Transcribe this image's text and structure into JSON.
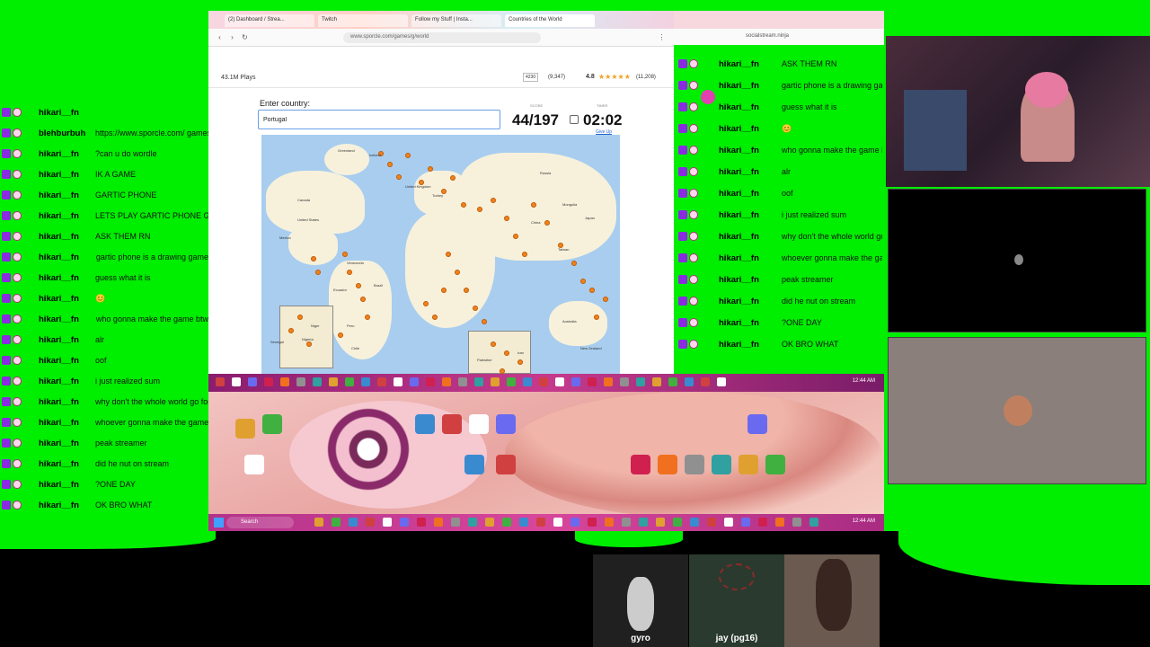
{
  "browser": {
    "tabs": [
      "(2) Dashboard / Strea...",
      "Twitch",
      "Follow my Stuff | Insta...",
      "Countries of the World"
    ],
    "url": "www.sporcle.com/games/g/world"
  },
  "quiz": {
    "plays": "43.1M Plays",
    "rating_count_a": "4230",
    "rating_count_b": "(9,347)",
    "rating": "4.8",
    "rating_count_c": "(11,208)",
    "enter_label": "Enter country:",
    "input_value": "Portugal",
    "score_caption": "SCORE",
    "score": "44/197",
    "timer_caption": "TIMER",
    "timer": "02:02",
    "give_up": "Give Up",
    "map_labels": [
      "Canada",
      "United States",
      "Mexico",
      "Brazil",
      "Russia",
      "China",
      "Australia",
      "Greenland",
      "Iceland",
      "Niger",
      "Nigeria",
      "Senegal",
      "Ecuador",
      "Iran",
      "Taiwan",
      "Mongolia",
      "New Zealand",
      "Palestine",
      "Venezuela",
      "United Kingdom",
      "Turkey",
      "Japan",
      "Peru",
      "Chile"
    ]
  },
  "left_chat": [
    {
      "name": "hikari__fn",
      "msg": "",
      "right": false
    },
    {
      "name": "blehburbuh",
      "msg": "https://www.sporcle.com/ games/g/world",
      "right": true
    },
    {
      "name": "hikari__fn",
      "msg": "?can u do wordle",
      "right": false
    },
    {
      "name": "hikari__fn",
      "msg": "IK A GAME",
      "right": false
    },
    {
      "name": "hikari__fn",
      "msg": "GARTIC PHONE",
      "right": false
    },
    {
      "name": "hikari__fn",
      "msg": "LETS PLAY GARTIC PHONE GUYS",
      "right": true
    },
    {
      "name": "hikari__fn",
      "msg": "ASK THEM RN",
      "right": false
    },
    {
      "name": "hikari__fn",
      "msg": "gartic phone is a drawing game",
      "right": true
    },
    {
      "name": "hikari__fn",
      "msg": "guess what it is",
      "right": false
    },
    {
      "name": "hikari__fn",
      "msg": "😊",
      "right": false
    },
    {
      "name": "hikari__fn",
      "msg": "who gonna make the game btw",
      "right": true
    },
    {
      "name": "hikari__fn",
      "msg": "alr",
      "right": false
    },
    {
      "name": "hikari__fn",
      "msg": "oof",
      "right": false
    },
    {
      "name": "hikari__fn",
      "msg": "i just realized sum",
      "right": false
    },
    {
      "name": "hikari__fn",
      "msg": "why don't the whole world go for America if they hate us so ..much",
      "right": true
    },
    {
      "name": "hikari__fn",
      "msg": "whoever gonna make the game send the link here",
      "right": true
    },
    {
      "name": "hikari__fn",
      "msg": "peak streamer",
      "right": false
    },
    {
      "name": "hikari__fn",
      "msg": "did he nut on stream",
      "right": false
    },
    {
      "name": "hikari__fn",
      "msg": "?ONE DAY",
      "right": false
    },
    {
      "name": "hikari__fn",
      "msg": "OK BRO WHAT",
      "right": false
    }
  ],
  "stream_chat": {
    "url": "socialstream.ninja",
    "messages": [
      {
        "name": "hikari__fn",
        "msg": "ASK THEM RN",
        "right": false
      },
      {
        "name": "hikari__fn",
        "msg": "gartic phone is a drawing game",
        "right": true
      },
      {
        "name": "hikari__fn",
        "msg": "guess what it is",
        "right": false
      },
      {
        "name": "hikari__fn",
        "msg": "😊",
        "right": false
      },
      {
        "name": "hikari__fn",
        "msg": "who gonna make the game btw",
        "right": true
      },
      {
        "name": "hikari__fn",
        "msg": "alr",
        "right": false
      },
      {
        "name": "hikari__fn",
        "msg": "oof",
        "right": false
      },
      {
        "name": "hikari__fn",
        "msg": "i just realized sum",
        "right": false
      },
      {
        "name": "hikari__fn",
        "msg": "why don't the whole world go for America if ..they hate us so much",
        "right": true
      },
      {
        "name": "hikari__fn",
        "msg": "whoever gonna make the game send the link here",
        "right": true
      },
      {
        "name": "hikari__fn",
        "msg": "peak streamer",
        "right": false
      },
      {
        "name": "hikari__fn",
        "msg": "did he nut on stream",
        "right": false
      },
      {
        "name": "hikari__fn",
        "msg": "?ONE DAY",
        "right": false
      },
      {
        "name": "hikari__fn",
        "msg": "OK BRO WHAT",
        "right": false
      }
    ]
  },
  "taskbar": {
    "search_placeholder": "Search",
    "clock_top": "12:44 AM",
    "clock_bottom": "12:44 AM"
  },
  "participants": [
    {
      "name": "gyro"
    },
    {
      "name": "jay (pg16)"
    },
    {
      "name": ""
    }
  ],
  "colors": {
    "chroma_green": "#00ee00",
    "twitch_purple": "#8a2be2",
    "map_ocean": "#a8cdef",
    "map_marker": "#f0821e",
    "taskbar_pink": "#d8469b"
  }
}
